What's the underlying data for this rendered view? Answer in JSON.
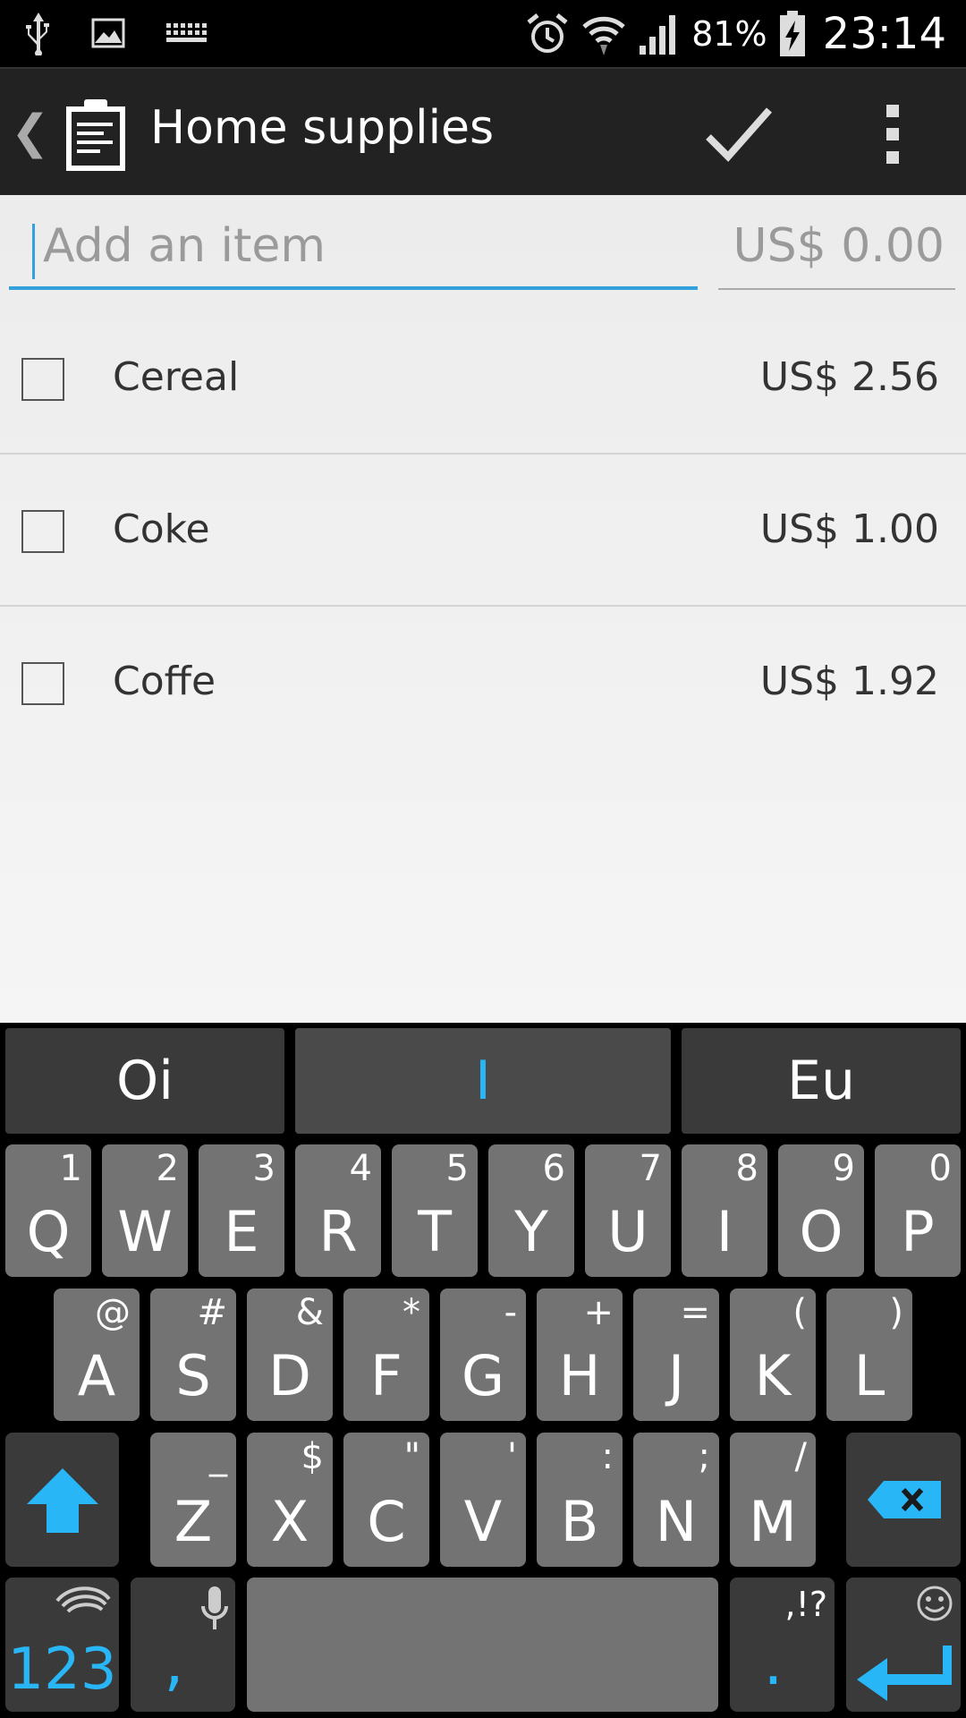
{
  "status_bar": {
    "battery_percent": "81%",
    "time": "23:14",
    "icons": [
      "usb-icon",
      "image-icon",
      "keyboard-icon",
      "alarm-icon",
      "wifi-icon",
      "signal-icon",
      "battery-charging-icon"
    ]
  },
  "action_bar": {
    "title": "Home supplies",
    "back_icon": "back-chevron-icon",
    "app_icon": "clipboard-icon",
    "done_icon": "checkmark-icon",
    "menu_icon": "overflow-menu-icon"
  },
  "add_item": {
    "placeholder": "Add an item",
    "price_placeholder": "US$ 0.00"
  },
  "items": [
    {
      "name": "Cereal",
      "price": "US$ 2.56",
      "checked": false
    },
    {
      "name": "Coke",
      "price": "US$ 1.00",
      "checked": false
    },
    {
      "name": "Coffe",
      "price": "US$ 1.92",
      "checked": false
    }
  ],
  "keyboard": {
    "suggestions": [
      "Oi",
      "I",
      "Eu"
    ],
    "row1": [
      {
        "key": "Q",
        "alt": "1"
      },
      {
        "key": "W",
        "alt": "2"
      },
      {
        "key": "E",
        "alt": "3"
      },
      {
        "key": "R",
        "alt": "4"
      },
      {
        "key": "T",
        "alt": "5"
      },
      {
        "key": "Y",
        "alt": "6"
      },
      {
        "key": "U",
        "alt": "7"
      },
      {
        "key": "I",
        "alt": "8"
      },
      {
        "key": "O",
        "alt": "9"
      },
      {
        "key": "P",
        "alt": "0"
      }
    ],
    "row2": [
      {
        "key": "A",
        "alt": "@"
      },
      {
        "key": "S",
        "alt": "#"
      },
      {
        "key": "D",
        "alt": "&"
      },
      {
        "key": "F",
        "alt": "*"
      },
      {
        "key": "G",
        "alt": "-"
      },
      {
        "key": "H",
        "alt": "+"
      },
      {
        "key": "J",
        "alt": "="
      },
      {
        "key": "K",
        "alt": "("
      },
      {
        "key": "L",
        "alt": ")"
      }
    ],
    "row3": [
      {
        "key": "Z",
        "alt": "_"
      },
      {
        "key": "X",
        "alt": "$"
      },
      {
        "key": "C",
        "alt": "\""
      },
      {
        "key": "V",
        "alt": "'"
      },
      {
        "key": "B",
        "alt": ":"
      },
      {
        "key": "N",
        "alt": ";"
      },
      {
        "key": "M",
        "alt": "/"
      }
    ],
    "symbols_label": "123",
    "comma_label": ",",
    "period_label": ".",
    "punct_alt": ",!?",
    "shift_icon": "shift-icon",
    "backspace_icon": "backspace-icon",
    "mic_icon": "microphone-icon",
    "emoji_icon": "emoji-icon",
    "enter_icon": "enter-icon",
    "swiftkey_icon": "swiftkey-logo-icon",
    "accent_color": "#29b6f6"
  }
}
